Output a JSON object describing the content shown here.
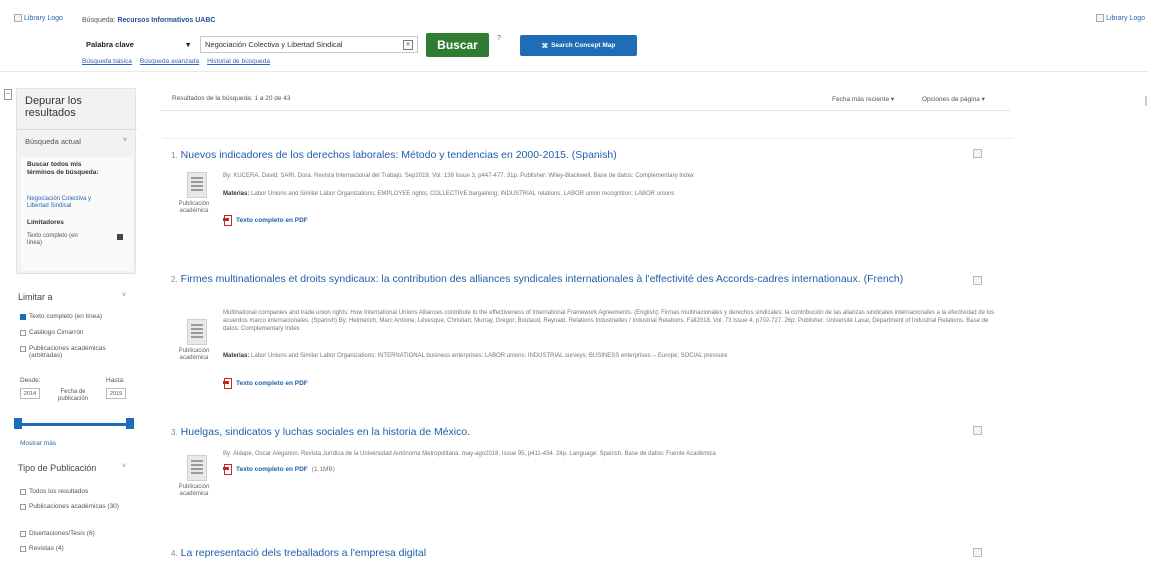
{
  "header": {
    "library_logo_left": "Library Logo",
    "library_logo_right": "Library Logo",
    "search_prefix": "Búsqueda:",
    "search_scope": "Recursos Informativos UABC",
    "field": "Palabra clave",
    "query": "Negociación Colectiva y Libertad Sindical",
    "search_button": "Buscar",
    "help": "?",
    "concept_map_button": "Search Concept Map",
    "links": [
      "Búsqueda básica",
      "Búsqueda avanzada",
      "Historial de búsqueda"
    ]
  },
  "sidebar": {
    "title": "Depurar los resultados",
    "current_search_label": "Búsqueda actual",
    "find_all": "Buscar todos mis términos de búsqueda:",
    "term": "Negociación Colectiva y Libertad Sindical",
    "limiters_label": "Limitadores",
    "limiter_item": "Texto completo (en línea)",
    "limit_to_label": "Limitar a",
    "limit_options": [
      {
        "label": "Texto completo (en línea)",
        "checked": true
      },
      {
        "label": "Catálogo Cimarrón",
        "checked": false
      },
      {
        "label": "Publicaciones académicas (arbitradas)",
        "checked": false
      }
    ],
    "date_from_label": "Desde:",
    "date_to_label": "Hasta:",
    "date_from": "2014",
    "date_to": "2019",
    "date_mid_label": "Fecha de publicación",
    "show_more": "Mostrar más",
    "pub_type_label": "Tipo de Publicación",
    "pub_types": [
      "Todos los resultados",
      "Publicaciones académicas (30)",
      "Disertaciones/Tesis (6)",
      "Revistas (4)"
    ]
  },
  "results": {
    "count_text": "Resultados de la búsqueda: 1 a 20 de 43",
    "sort": "Fecha más reciente ▾",
    "page_options": "Opciones de página ▾",
    "items": [
      {
        "num": "1.",
        "title": "Nuevos indicadores de los derechos laborales: Método y tendencias en 2000-2015. (Spanish)",
        "pub_type": "Publicación académica",
        "meta": "By: KUCERA, David; SARI, Dora. Revista Internacional del Trabajo. Sep2019, Vol. 138 Issue 3, p447-477. 31p. Publisher: Wiley-Blackwell. Base de datos: Complementary Index",
        "subjects_label": "Materias:",
        "subjects": "Labor Unions and Similar Labor Organizations; EMPLOYEE rights; COLLECTIVE bargaining; INDUSTRIAL relations; LABOR union recognition; LABOR unions",
        "pdf": "Texto completo en PDF",
        "pdf_size": ""
      },
      {
        "num": "2.",
        "title": "Firmes multinationales et droits syndicaux: la contribution des alliances syndicales internationales à l'effectivité des Accords-cadres internationaux. (French)",
        "pub_type": "Publicación académica",
        "meta": "Multinational companies and trade union rights: How International Unions Alliances contribute to the effectiveness of International Framework Agreements. (English); Firmas multinacionales y derechos sindicales: la contribución de las alianzas sindicales internacionales a la efectividad de los acuerdos marco internacionales. (Spanish) By: Helmerich, Marc Antoine; Lévesque, Christian; Murray, Gregor; Boutaud, Reynald. Relations Industrielles / Industrial Relations. Fall2018, Vol. 73 Issue 4, p702-727. 26p. Publisher: Université Laval, Department of Industrial Relations. Base de datos: Complementary Index",
        "subjects_label": "Materias:",
        "subjects": "Labor Unions and Similar Labor Organizations; INTERNATIONAL business enterprises; LABOR unions; INDUSTRIAL surveys; BUSINESS enterprises -- Europe; SOCIAL pressure",
        "pdf": "Texto completo en PDF",
        "pdf_size": ""
      },
      {
        "num": "3.",
        "title": "Huelgas, sindicatos y luchas sociales en la historia de México.",
        "pub_type": "Publicación académica",
        "meta": "By: Aldape, Oscar Alegarion. Revista Jurídica de la Universidad Autónoma Metropolitana. may-ago2018, Issue 95, p411-434. 24p. Language: Spanish. Base de datos: Fuente Académica",
        "subjects_label": "",
        "subjects": "",
        "pdf": "Texto completo en PDF",
        "pdf_size": "(1.1MB)"
      },
      {
        "num": "4.",
        "title": "La representació dels treballadors a l'empresa digital",
        "pub_type": "",
        "meta": "",
        "subjects_label": "",
        "subjects": "",
        "pdf": "",
        "pdf_size": ""
      }
    ]
  }
}
